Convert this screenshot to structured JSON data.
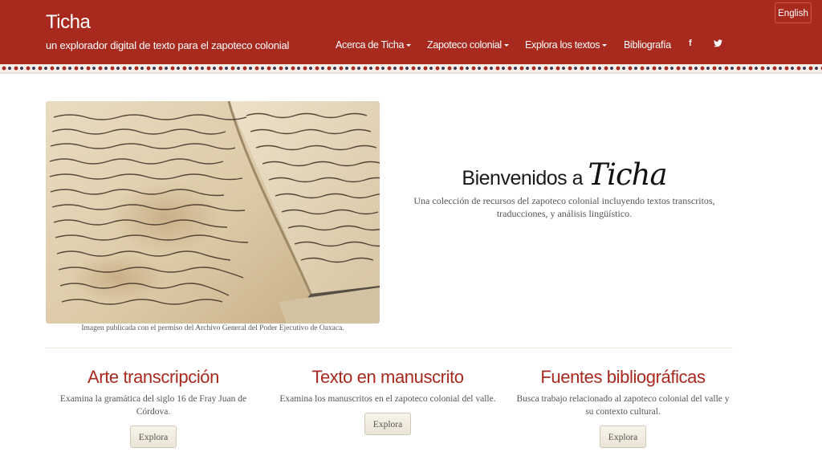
{
  "header": {
    "title": "Ticha",
    "subtitle": "un explorador digital de texto para el zapoteco colonial",
    "lang_button": "English",
    "nav": [
      {
        "label": "Acerca de Ticha",
        "dropdown": true
      },
      {
        "label": "Zapoteco colonial",
        "dropdown": true
      },
      {
        "label": "Explora los textos",
        "dropdown": true
      },
      {
        "label": "Bibliografía",
        "dropdown": false
      }
    ],
    "social": [
      {
        "icon": "facebook-icon",
        "glyph": "f"
      },
      {
        "icon": "twitter-icon",
        "glyph": "t"
      }
    ]
  },
  "hero": {
    "caption": "Imagen publicada con el permiso del Archivo General del Poder Ejecutivo de Oaxaca.",
    "welcome_prefix": "Bienvenidos a",
    "welcome_name": "Ticha",
    "description": "Una colección de recursos del zapoteco colonial incluyendo textos transcritos, traducciones, y análisis lingüístico."
  },
  "features": [
    {
      "title": "Arte transcripción",
      "description": "Examina la gramática del siglo 16 de Fray Juan de Córdova.",
      "button": "Explora"
    },
    {
      "title": "Texto en manuscrito",
      "description": "Examina los manuscritos en el zapoteco colonial del valle.",
      "button": "Explora"
    },
    {
      "title": "Fuentes bibliográficas",
      "description": "Busca trabajo relacionado al zapoteco colonial del valle y su contexto cultural.",
      "button": "Explora"
    }
  ],
  "colors": {
    "brand_red": "#a82a1e",
    "page_bg": "#ffffff"
  }
}
